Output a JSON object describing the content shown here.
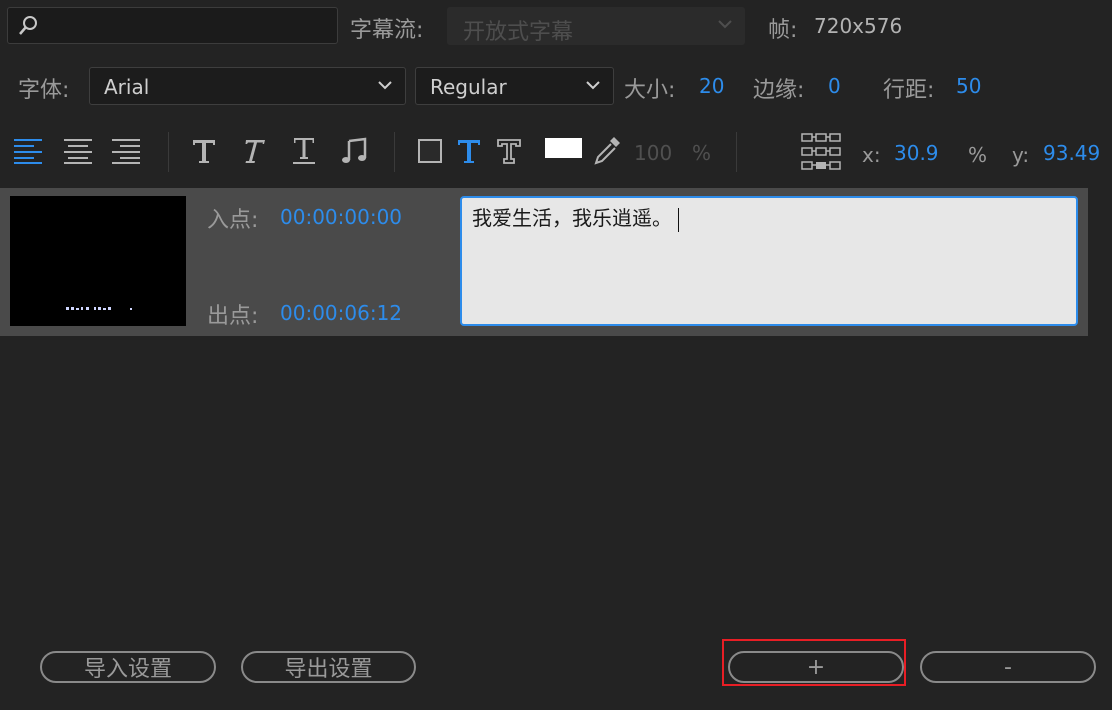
{
  "search": {
    "placeholder": ""
  },
  "caption_stream": {
    "label": "字幕流:",
    "value": "开放式字幕"
  },
  "frame": {
    "label": "帧:",
    "value": "720x576"
  },
  "font": {
    "label": "字体:",
    "family": "Arial",
    "style": "Regular"
  },
  "size": {
    "label": "大小:",
    "value": "20"
  },
  "edge": {
    "label": "边缘:",
    "value": "0"
  },
  "leading": {
    "label": "行距:",
    "value": "50"
  },
  "toolbar": {
    "opacity_value": "100",
    "opacity_unit": "%",
    "x_label": "x:",
    "x_value": "30.9",
    "percent_label": "%",
    "y_label": "y:",
    "y_value": "93.49",
    "accent_color": "#2d8ceb"
  },
  "caption": {
    "in_label": "入点:",
    "in_time": "00:00:00:00",
    "out_label": "出点:",
    "out_time": "00:00:06:12",
    "text": "我爱生活，我乐逍遥。"
  },
  "buttons": {
    "import_settings": "导入设置",
    "export_settings": "导出设置",
    "add": "+",
    "remove": "-"
  }
}
